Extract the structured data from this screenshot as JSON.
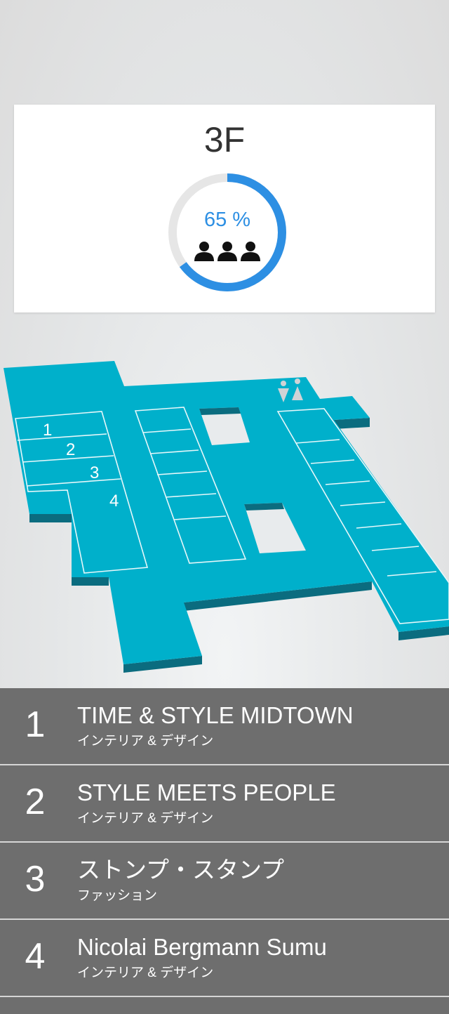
{
  "floor": {
    "title": "3F",
    "occupancy_label": "65 %",
    "occupancy_percent": 65,
    "occupancy_icon": "people-icon",
    "accent_color": "#2d8fe3",
    "track_color": "#e6e6e6"
  },
  "map": {
    "floor_color": "#00b0cb",
    "edge_color": "#0b6c7f",
    "shop_numbers": [
      "1",
      "2",
      "3",
      "4"
    ],
    "restroom_icon": "restroom-icon"
  },
  "shops": [
    {
      "number": "1",
      "name": "TIME & STYLE MIDTOWN",
      "category": "インテリア & デザイン"
    },
    {
      "number": "2",
      "name": "STYLE MEETS PEOPLE",
      "category": "インテリア & デザイン"
    },
    {
      "number": "3",
      "name": "ストンプ・スタンプ",
      "category": "ファッション"
    },
    {
      "number": "4",
      "name": "Nicolai Bergmann Sumu",
      "category": "インテリア & デザイン"
    }
  ]
}
